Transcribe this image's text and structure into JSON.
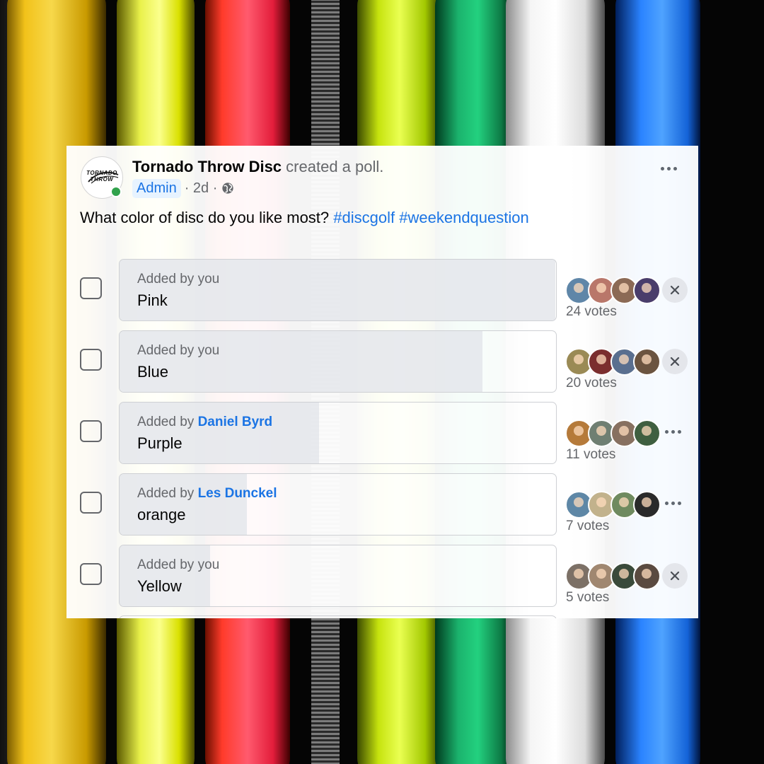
{
  "post": {
    "author": "Tornado Throw Disc",
    "action": "created a poll.",
    "badge": "Admin",
    "time": "· 2d ·",
    "question": "What color of disc do you like most?",
    "hashtags": [
      "#discgolf",
      "#weekendquestion"
    ],
    "logo_text_line1": "TORNADO",
    "logo_text_line2": "THROW"
  },
  "poll": {
    "added_by_prefix": "Added by",
    "options": [
      {
        "added_by": "you",
        "added_by_is_link": false,
        "label": "Pink",
        "votes": "24 votes",
        "vote_share": 1.0,
        "action": "remove",
        "voter_colors": [
          "#5f86a8",
          "#b9776a",
          "#8c6a55",
          "#4a3d6b"
        ]
      },
      {
        "added_by": "you",
        "added_by_is_link": false,
        "label": "Blue",
        "votes": "20 votes",
        "vote_share": 0.833,
        "action": "remove",
        "voter_colors": [
          "#9a8a55",
          "#7b2e2e",
          "#5a6f8f",
          "#6b5440"
        ]
      },
      {
        "added_by": "Daniel Byrd",
        "added_by_is_link": true,
        "label": "Purple",
        "votes": "11 votes",
        "vote_share": 0.458,
        "action": "more",
        "voter_colors": [
          "#b57a3a",
          "#6f7f72",
          "#877060",
          "#3f5f40"
        ]
      },
      {
        "added_by": "Les Dunckel",
        "added_by_is_link": true,
        "label": "orange",
        "votes": "7 votes",
        "vote_share": 0.292,
        "action": "more",
        "voter_colors": [
          "#5e87a6",
          "#c2b28c",
          "#6f8a5f",
          "#2a2a2a"
        ]
      },
      {
        "added_by": "you",
        "added_by_is_link": false,
        "label": "Yellow",
        "votes": "5 votes",
        "vote_share": 0.208,
        "action": "remove",
        "voter_colors": [
          "#7c7066",
          "#a08770",
          "#3a4a3a",
          "#5a4a40"
        ]
      }
    ]
  },
  "colors": {
    "link": "#1b74e4",
    "secondary_text": "#65676b",
    "online": "#31a24c",
    "fill": "#e4e6eb"
  },
  "icons": {
    "globe": "globe-icon",
    "more": "more-horizontal-icon",
    "remove": "close-icon",
    "checkbox": "checkbox-icon"
  }
}
